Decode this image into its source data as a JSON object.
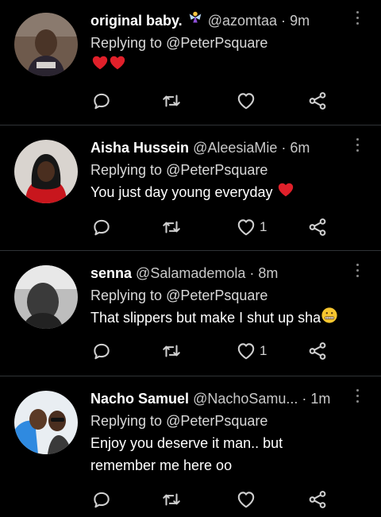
{
  "tweets": [
    {
      "name": "original baby.",
      "name_emoji": "fairy-emoji",
      "handle": "@azomtaa",
      "separator": "·",
      "time": "9m",
      "reply_prefix": "Replying to",
      "reply_to": "@PeterPsquare",
      "text": "",
      "trailing_emoji": "two-red-hearts-emoji",
      "likes": "",
      "avatar_desc": "woman-avatar"
    },
    {
      "name": "Aisha Hussein",
      "handle": "@AleesiaMie",
      "separator": "·",
      "time": "6m",
      "reply_prefix": "Replying to",
      "reply_to": "@PeterPsquare",
      "text": "You just day young everyday",
      "trailing_emoji": "red-heart-emoji",
      "likes": "1",
      "avatar_desc": "woman-in-hijab-avatar"
    },
    {
      "name": "senna",
      "handle": "@Salamademola",
      "separator": "·",
      "time": "8m",
      "reply_prefix": "Replying to",
      "reply_to": "@PeterPsquare",
      "text": "That slippers but make I shut up sha",
      "trailing_emoji": "zipper-mouth-face-emoji",
      "likes": "1",
      "avatar_desc": "grayscale-man-avatar"
    },
    {
      "name": "Nacho Samuel",
      "handle": "@NachoSamu...",
      "separator": "·",
      "time": "1m",
      "reply_prefix": "Replying to",
      "reply_to": "@PeterPsquare",
      "text": "Enjoy you deserve it man.. but remember me here oo",
      "trailing_emoji": "",
      "likes": "",
      "avatar_desc": "two-men-avatar"
    }
  ],
  "icons": {
    "reply": "reply-icon",
    "retweet": "retweet-icon",
    "like": "heart-icon",
    "share": "share-icon",
    "more": "more-vertical-icon"
  },
  "colors": {
    "background": "#000000",
    "divider": "#2f3336",
    "icon": "#d0d0d0",
    "heart_emoji": "#e0202a"
  }
}
